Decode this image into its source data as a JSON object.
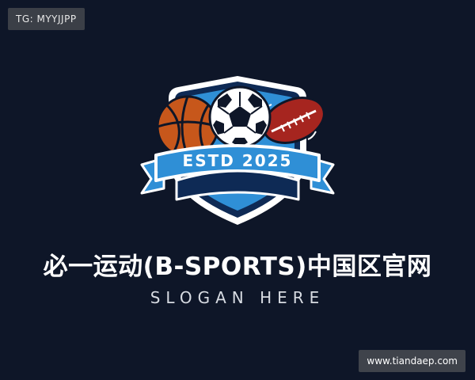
{
  "tag_badge": {
    "text": "TG: MYYJJPP"
  },
  "emblem": {
    "banner_text": "ESTD 2025",
    "icons": [
      "basketball-icon",
      "soccer-ball-icon",
      "american-football-icon"
    ],
    "colors": {
      "shield_blue": "#2f8fd6",
      "shield_navy": "#0e2a55",
      "basketball": "#c7571b",
      "football": "#a6251f"
    }
  },
  "title": "必一运动(B-SPORTS)中国区官网",
  "slogan": "SLOGAN HERE",
  "url_badge": {
    "text": "www.tiandaep.com"
  },
  "colors": {
    "background": "#0e1628",
    "text": "#ffffff"
  }
}
